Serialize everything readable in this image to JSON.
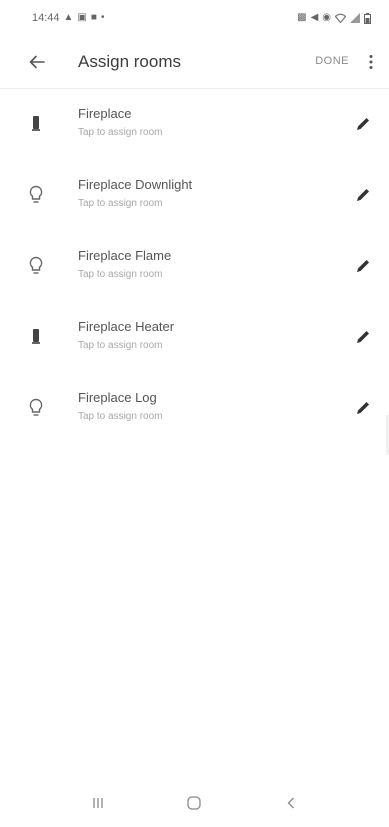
{
  "status_bar": {
    "time": "14:44",
    "left_icons": [
      "alert-icon",
      "image-icon",
      "video-icon",
      "dot-icon"
    ],
    "right_icons": [
      "nfc-icon",
      "mute-icon",
      "location-icon",
      "wifi-icon",
      "signal-icon",
      "battery-icon"
    ]
  },
  "app_bar": {
    "title": "Assign rooms",
    "done_label": "DONE",
    "back_icon": "arrow-left-icon",
    "more_icon": "more-vert-icon"
  },
  "devices": [
    {
      "name": "Fireplace",
      "subtitle": "Tap to assign room",
      "icon": "switch-icon"
    },
    {
      "name": "Fireplace Downlight",
      "subtitle": "Tap to assign room",
      "icon": "bulb-icon"
    },
    {
      "name": "Fireplace Flame",
      "subtitle": "Tap to assign room",
      "icon": "bulb-icon"
    },
    {
      "name": "Fireplace Heater",
      "subtitle": "Tap to assign room",
      "icon": "switch-icon"
    },
    {
      "name": "Fireplace Log",
      "subtitle": "Tap to assign room",
      "icon": "bulb-icon"
    }
  ],
  "nav_bar": {
    "recents_icon": "recents-icon",
    "home_icon": "home-icon",
    "back_icon": "nav-back-icon"
  },
  "colors": {
    "text_primary": "#555555",
    "text_secondary": "#a8a8a8",
    "icon": "#444444",
    "background": "#ffffff"
  }
}
